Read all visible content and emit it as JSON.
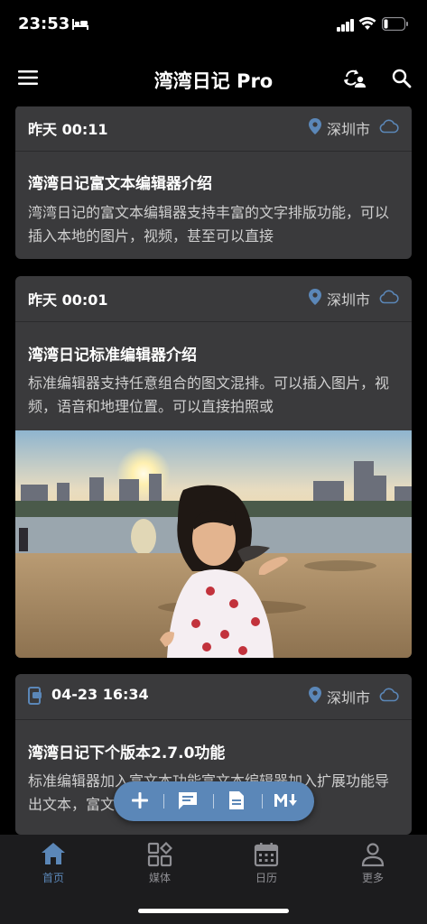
{
  "status": {
    "time": "23:53"
  },
  "app": {
    "title": "湾湾日记 Pro"
  },
  "cards": [
    {
      "date": "昨天 00:11",
      "location": "深圳市",
      "title": "湾湾日记富文本编辑器介绍",
      "body": "湾湾日记的富文本编辑器支持丰富的文字排版功能，可以插入本地的图片，视频，甚至可以直接"
    },
    {
      "date": "昨天 00:01",
      "location": "深圳市",
      "title": "湾湾日记标准编辑器介绍",
      "body": "标准编辑器支持任意组合的图文混排。可以插入图片，视频，语音和地理位置。可以直接拍照或"
    },
    {
      "date": "04-23 16:34",
      "location": "深圳市",
      "title": "湾湾日记下个版本2.7.0功能",
      "body": "标准编辑器加入富文本功能富文本编辑器加入扩展功能导出文本，富文"
    }
  ],
  "tabs": [
    {
      "label": "首页"
    },
    {
      "label": "媒体"
    },
    {
      "label": "日历"
    },
    {
      "label": "更多"
    }
  ],
  "colors": {
    "accent": "#5b87b8",
    "card": "#3a3a3c",
    "tabbar": "#1c1c1e"
  }
}
